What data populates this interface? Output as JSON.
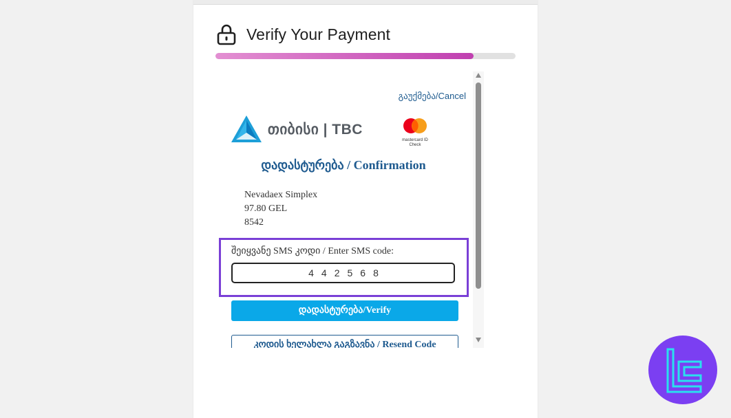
{
  "page": {
    "title": "Verify Your Payment",
    "progress_fraction": 0.86
  },
  "frame": {
    "cancel_label": "გაუქმება/Cancel",
    "bank_name": "თიბისი | TBC",
    "card_brand_caption": "mastercard ID Check",
    "heading": "დადასტურება / Confirmation",
    "merchant": "Nevadaex Simplex",
    "amount": "97.80 GEL",
    "card_last_digits": "8542",
    "sms_label": "შეიყვანე SMS კოდი / Enter SMS code:",
    "sms_value": "442568",
    "verify_label": "დადასტურება/Verify",
    "resend_label": "კოდის ხელახლა გაგზავნა / Resend Code"
  },
  "colors": {
    "accent_purple": "#7a3fd6",
    "verify_blue": "#0aa8e8",
    "link_blue": "#1e5a8f",
    "badge_purple": "#7b3ff2",
    "badge_cyan": "#29e0ee"
  },
  "icons": {
    "title": "lock-icon",
    "bank": "tbc-triangle-logo",
    "card": "mastercard-logo",
    "badge": "brand-badge-logo"
  }
}
